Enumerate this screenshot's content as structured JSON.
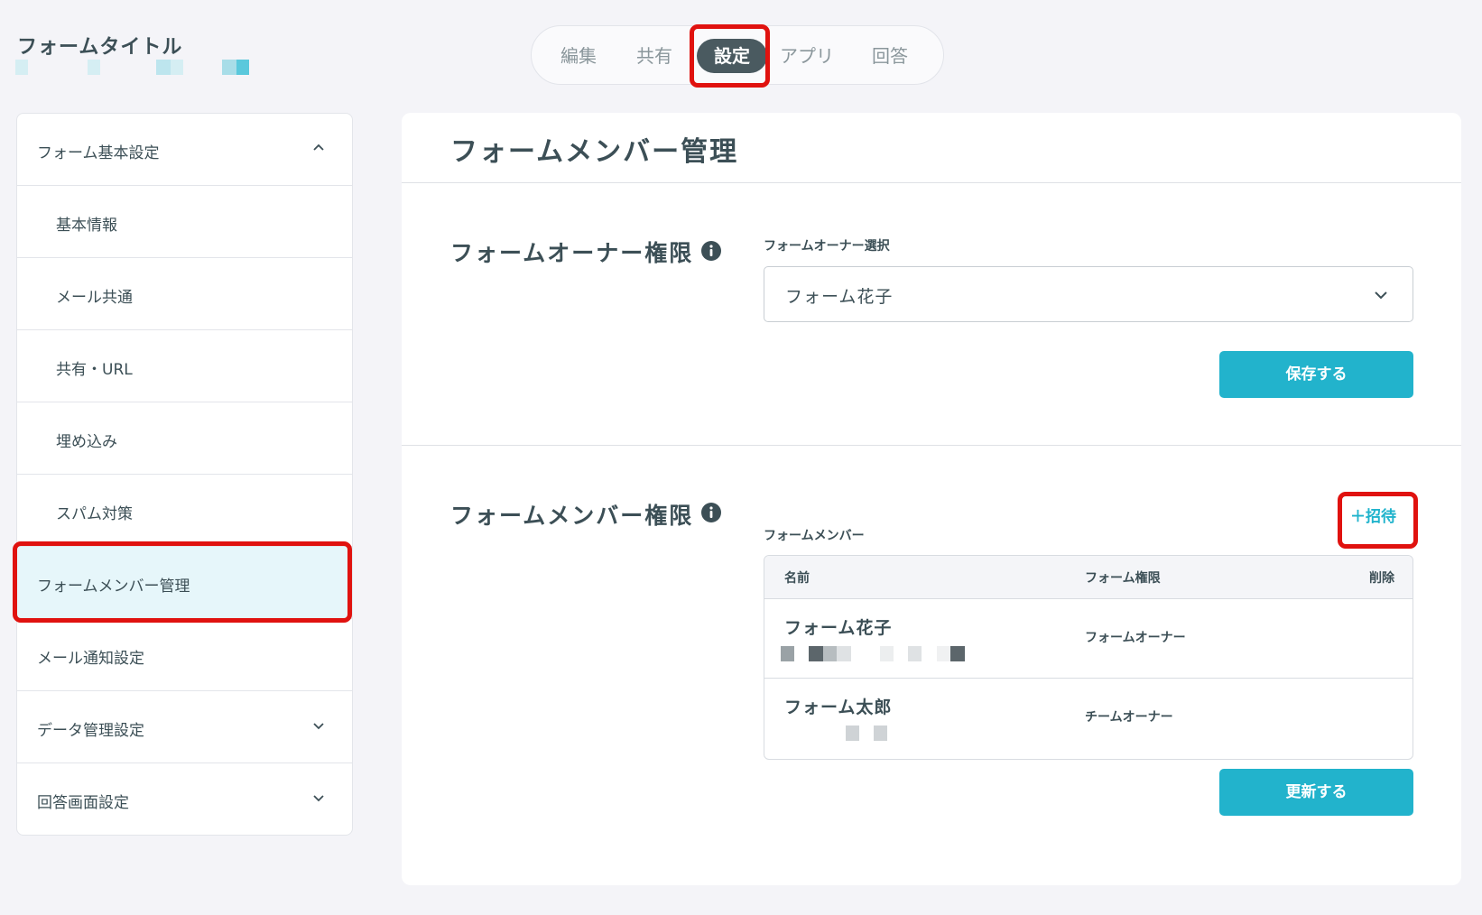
{
  "header": {
    "form_title": "フォームタイトル",
    "tabs": [
      "編集",
      "共有",
      "設定",
      "アプリ",
      "回答"
    ],
    "active_tab": "設定"
  },
  "sidebar": {
    "items": [
      {
        "label": "フォーム基本設定",
        "icon": "chevron-up-icon"
      },
      {
        "label": "基本情報"
      },
      {
        "label": "メール共通"
      },
      {
        "label": "共有・URL"
      },
      {
        "label": "埋め込み"
      },
      {
        "label": "スパム対策"
      },
      {
        "label": "フォームメンバー管理",
        "active": true
      },
      {
        "label": "メール通知設定"
      },
      {
        "label": "データ管理設定",
        "icon": "chevron-down-icon"
      },
      {
        "label": "回答画面設定",
        "icon": "chevron-down-icon"
      }
    ]
  },
  "main": {
    "page_title": "フォームメンバー管理",
    "owner_section": {
      "title": "フォームオーナー権限",
      "field_label": "フォームオーナー選択",
      "selected_value": "フォーム花子",
      "save_button": "保存する"
    },
    "member_section": {
      "title": "フォームメンバー権限",
      "field_label": "フォームメンバー",
      "invite_button": "＋招待",
      "columns": [
        "名前",
        "フォーム権限",
        "削除"
      ],
      "rows": [
        {
          "name": "フォーム花子",
          "role": "フォームオーナー"
        },
        {
          "name": "フォーム太郎",
          "role": "チームオーナー"
        }
      ],
      "update_button": "更新する"
    }
  },
  "colors": {
    "accent": "#22b3cc",
    "active_tab_bg": "#4a5a60",
    "active_sidebar_bg": "#e6f6fa",
    "highlight": "#e0120f",
    "text": "#3c4f56"
  }
}
